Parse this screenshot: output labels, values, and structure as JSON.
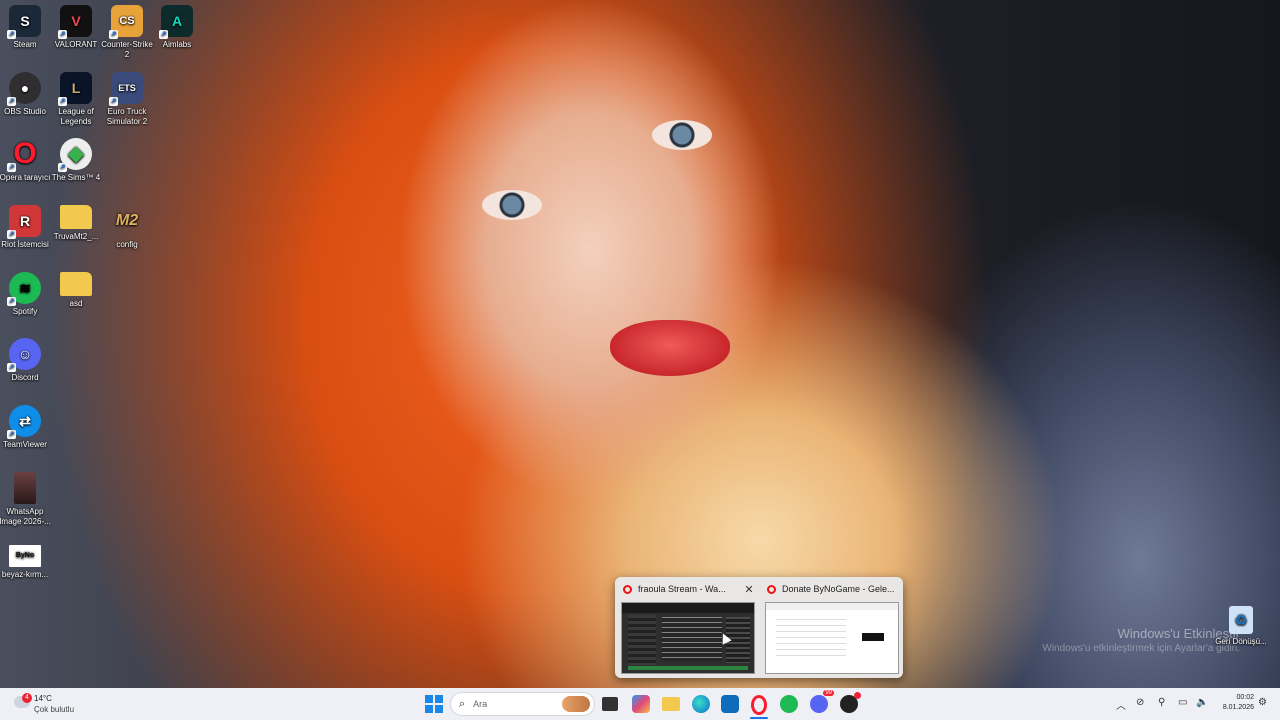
{
  "desktop": {
    "icons": [
      {
        "name": "steam",
        "label": "Steam",
        "glyph": "S",
        "bg": "#1b2838"
      },
      {
        "name": "valorant",
        "label": "VALORANT",
        "glyph": "V",
        "bg": "#f44850"
      },
      {
        "name": "counter-strike",
        "label": "Counter-Strike 2",
        "glyph": "CS",
        "bg": "#e8a23a"
      },
      {
        "name": "aimlabs",
        "label": "Aimlabs",
        "glyph": "A",
        "bg": "#13a89e"
      },
      {
        "name": "obs-studio",
        "label": "OBS Studio",
        "glyph": "●",
        "bg": "#302e31"
      },
      {
        "name": "league-of-legends",
        "label": "League of Legends",
        "glyph": "L",
        "bg": "#c8aa6e"
      },
      {
        "name": "euro-truck-simulator",
        "label": "Euro Truck Simulator 2",
        "glyph": "ETS",
        "bg": "#3a4a7a"
      },
      {
        "name": "opera",
        "label": "Opera tarayıcı",
        "glyph": "O",
        "bg": "#ff1b2d"
      },
      {
        "name": "the-sims",
        "label": "The Sims™ 4",
        "glyph": "◆",
        "bg": "#37b24d"
      },
      {
        "name": "riot-client",
        "label": "Riot İstemcisi",
        "glyph": "R",
        "bg": "#d13639"
      },
      {
        "name": "truvamt2-folder",
        "label": "TruvaMt2_...",
        "glyph": "",
        "bg": "#f2c94c"
      },
      {
        "name": "config",
        "label": "config",
        "glyph": "M2",
        "bg": "#7a1a1a"
      },
      {
        "name": "spotify",
        "label": "Spotify",
        "glyph": "≋",
        "bg": "#1db954"
      },
      {
        "name": "asd-folder",
        "label": "asd",
        "glyph": "",
        "bg": "#f2c94c"
      },
      {
        "name": "discord",
        "label": "Discord",
        "glyph": "☺",
        "bg": "#5865f2"
      },
      {
        "name": "teamviewer",
        "label": "TeamViewer",
        "glyph": "⇄",
        "bg": "#0e8ee9"
      },
      {
        "name": "whatsapp-image",
        "label": "WhatsApp Image 2026-...",
        "glyph": "",
        "bg": "#5a3030"
      },
      {
        "name": "beyaz-kirm",
        "label": "beyaz-kırm...",
        "glyph": "ByNo",
        "bg": "#ffffff"
      },
      {
        "name": "recycle-bin",
        "label": "Geri Dönüşü...",
        "glyph": "♻",
        "bg": "#cfe3f7"
      }
    ]
  },
  "watermark": {
    "title": "Windows'u Etkinleştir",
    "subtitle": "Windows'u etkinleştirmek için Ayarlar'a gidin."
  },
  "preview": {
    "windows": [
      {
        "title": "fraoula Stream - Wa...",
        "close": "✕"
      },
      {
        "title": "Donate ByNoGame - Gele..."
      }
    ]
  },
  "taskbar": {
    "weather": {
      "temp": "14°C",
      "condition": "Çok bulutlu",
      "badge": "4"
    },
    "search": {
      "placeholder": "Ara"
    },
    "clock": {
      "time": "00:02",
      "date": "8.01.2026"
    },
    "discord_badge": "99"
  }
}
